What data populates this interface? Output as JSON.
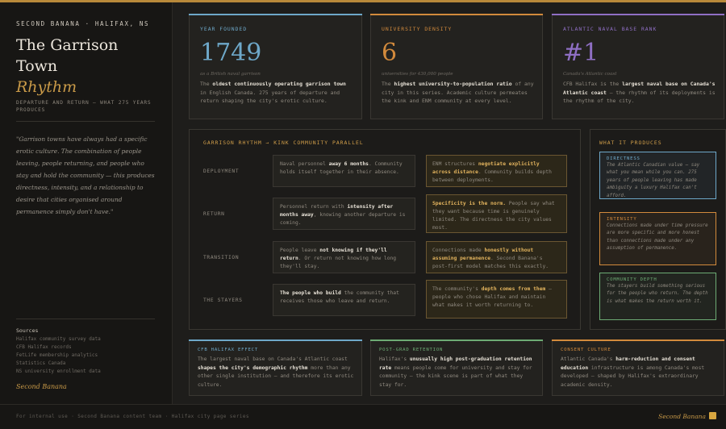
{
  "sidebar": {
    "kicker": "SECOND BANANA · HALIFAX, NS",
    "title_line1": "The Garrison",
    "title_line2": "Town",
    "title_line3": "Rhythm",
    "subtitle": "DEPARTURE AND RETURN — WHAT 275 YEARS PRODUCES",
    "quote": "\"Garrison towns have always had a specific erotic culture. The combination of people leaving, people returning, and people who stay and hold the community — this produces directness, intensity, and a relationship to desire that cities organised around permanence simply don't have.\"",
    "sources_heading": "Sources",
    "sources": [
      "Halifax community survey data",
      "CFB Halifax records",
      "FetLife membership analytics",
      "Statistics Canada",
      "NS university enrollment data"
    ],
    "brand": "Second Banana"
  },
  "stats": [
    {
      "label": "YEAR FOUNDED",
      "value": "1749",
      "caption": "as a British naval garrison",
      "pre": "The ",
      "bold": "oldest continuously operating garrison town",
      "post": " in English Canada. 275 years of departure and return shaping the city's erotic culture.",
      "color": "#6ea8c9"
    },
    {
      "label": "UNIVERSITY DENSITY",
      "value": "6",
      "caption": "universities for 430,000 people",
      "pre": "The ",
      "bold": "highest university-to-population ratio",
      "post": " of any city in this series. Academic culture permeates the kink and ENM community at every level.",
      "color": "#d28a3c"
    },
    {
      "label": "ATLANTIC NAVAL BASE RANK",
      "value": "#1",
      "caption": "Canada's Atlantic coast",
      "pre": "CFB Halifax is the ",
      "bold": "largest naval base on Canada's Atlantic coast",
      "post": " — the rhythm of its deployments is the rhythm of the city.",
      "color": "#8f6fc4"
    }
  ],
  "parallel": {
    "title": "GARRISON RHYTHM → KINK COMMUNITY PARALLEL",
    "rows": [
      {
        "label": "DEPLOYMENT",
        "left_pre": "Naval personnel ",
        "left_bold": "away 6 months",
        "left_post": ". Community holds itself together in their absence.",
        "right_pre": "ENM structures ",
        "right_bold": "negotiate explicitly across distance",
        "right_post": ". Community builds depth between deployments."
      },
      {
        "label": "RETURN",
        "left_pre": "Personnel return with ",
        "left_bold": "intensity after months away",
        "left_post": ", knowing another departure is coming.",
        "right_pre": "",
        "right_bold": "Specificity is the norm.",
        "right_post": " People say what they want because time is genuinely limited. The directness the city values most."
      },
      {
        "label": "TRANSITION",
        "left_pre": "People leave ",
        "left_bold": "not knowing if they'll return",
        "left_post": ". Or return not knowing how long they'll stay.",
        "right_pre": "Connections made ",
        "right_bold": "honestly without assuming permanence",
        "right_post": ". Second Banana's post-first model matches this exactly."
      },
      {
        "label": "THE STAYERS",
        "left_pre": "",
        "left_bold": "The people who build",
        "left_post": " the community that receives those who leave and return.",
        "right_pre": "The community's ",
        "right_bold": "depth comes from them",
        "right_post": " — people who chose Halifax and maintain what makes it worth returning to."
      }
    ]
  },
  "produces": {
    "title": "WHAT IT PRODUCES",
    "items": [
      {
        "heading": "DIRECTNESS",
        "text": "The Atlantic Canadian value — say what you mean while you can. 275 years of people leaving has made ambiguity a luxury Halifax can't afford.",
        "color": "#6ea8c9"
      },
      {
        "heading": "INTENSITY",
        "text": "Connections made under time pressure are more specific and more honest than connections made under any assumption of permanence.",
        "color": "#d28a3c"
      },
      {
        "heading": "COMMUNITY DEPTH",
        "text": "The stayers build something serious for the people who return. The depth is what makes the return worth it.",
        "color": "#6dab74"
      }
    ]
  },
  "bottom": [
    {
      "label": "CFB HALIFAX EFFECT",
      "pre": "The largest naval base on Canada's Atlantic coast ",
      "bold": "shapes the city's demographic rhythm",
      "post": " more than any other single institution — and therefore its erotic culture.",
      "color": "#6ea8c9"
    },
    {
      "label": "POST-GRAD RETENTION",
      "pre": "Halifax's ",
      "bold": "unusually high post-graduation retention rate",
      "post": " means people come for university and stay for community — the kink scene is part of what they stay for.",
      "color": "#6dab74"
    },
    {
      "label": "CONSENT CULTURE",
      "pre": "Atlantic Canada's ",
      "bold": "harm-reduction and consent education",
      "post": " infrastructure is among Canada's most developed — shaped by Halifax's extraordinary academic density.",
      "color": "#d28a3c"
    }
  ],
  "footer": {
    "text": "For internal use · Second Banana content team · Halifax city page series",
    "brand": "Second Banana"
  }
}
